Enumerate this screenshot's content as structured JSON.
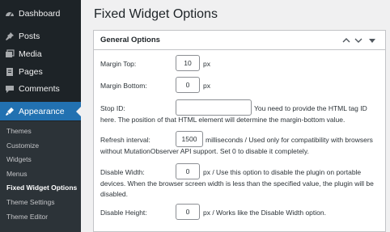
{
  "sidebar": {
    "items": [
      {
        "label": "Dashboard",
        "icon": "dashboard-icon"
      },
      {
        "label": "Posts",
        "icon": "pin-icon"
      },
      {
        "label": "Media",
        "icon": "media-icon"
      },
      {
        "label": "Pages",
        "icon": "pages-icon"
      },
      {
        "label": "Comments",
        "icon": "comments-icon"
      },
      {
        "label": "Appearance",
        "icon": "appearance-icon",
        "active": true
      }
    ],
    "submenu": [
      "Themes",
      "Customize",
      "Widgets",
      "Menus",
      "Fixed Widget Options",
      "Theme Settings",
      "Theme Editor"
    ],
    "current_submenu": "Fixed Widget Options"
  },
  "page": {
    "title": "Fixed Widget Options"
  },
  "panel": {
    "title": "General Options",
    "fields": {
      "margin_top": {
        "label": "Margin Top:",
        "value": "10",
        "unit": "px"
      },
      "margin_bottom": {
        "label": "Margin Bottom:",
        "value": "0",
        "unit": "px"
      },
      "stop_id": {
        "label": "Stop ID:",
        "value": "",
        "help_line1": "You need to provide the HTML tag ID",
        "help_line2": "here. The position of that HTML element will determine the margin-bottom value."
      },
      "refresh_interval": {
        "label": "Refresh interval:",
        "value": "1500",
        "help_line1": "milliseconds / Used only for compatibility with browsers",
        "help_line2": "without MutationObserver API support. Set 0 to disable it completely."
      },
      "disable_width": {
        "label": "Disable Width:",
        "value": "0",
        "help_line1": "px / Use this option to disable the plugin on portable",
        "help_line2": "devices. When the browser screen width is less than the specified value, the plugin will be",
        "help_line3": "disabled."
      },
      "disable_height": {
        "label": "Disable Height:",
        "value": "0",
        "help_line1": "px / Works like the Disable Width option."
      }
    }
  },
  "colors": {
    "sidebar_bg": "#1d2327",
    "submenu_bg": "#2c3338",
    "accent": "#2271b1",
    "page_bg": "#f0f0f1"
  }
}
